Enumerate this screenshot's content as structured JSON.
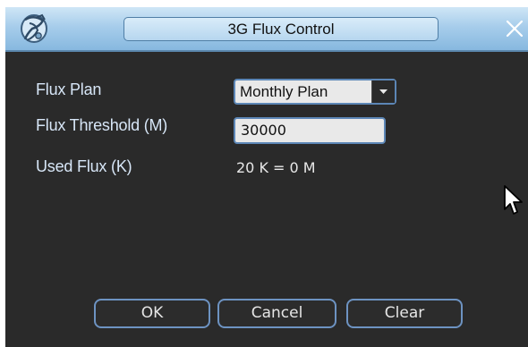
{
  "window": {
    "title": "3G Flux Control",
    "icons": {
      "logo": "app-logo-icon",
      "close": "close-icon",
      "cursor": "mouse-pointer-icon"
    }
  },
  "fields": {
    "flux_plan": {
      "label": "Flux Plan",
      "value": "Monthly Plan"
    },
    "flux_threshold": {
      "label": "Flux Threshold (M)",
      "value": "30000"
    },
    "used_flux": {
      "label": "Used Flux (K)",
      "value": "20 K = 0 M"
    }
  },
  "buttons": {
    "ok": "OK",
    "cancel": "Cancel",
    "clear": "Clear"
  },
  "colors": {
    "background": "#2a2a2a",
    "titlebar": "#a7cdeb",
    "label": "#d7e6f7",
    "input_border": "#5c86b6",
    "button_border": "#6d93c2"
  }
}
